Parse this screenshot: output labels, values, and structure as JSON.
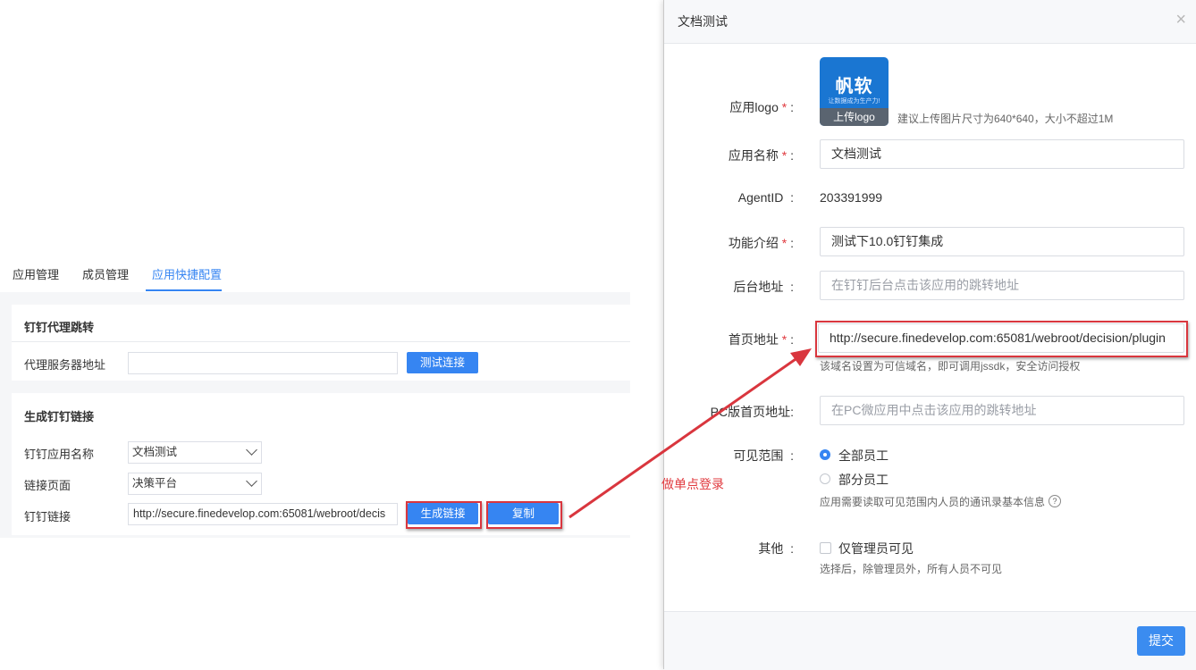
{
  "tabs": [
    {
      "label": "应用管理"
    },
    {
      "label": "成员管理"
    },
    {
      "label": "应用快捷配置"
    }
  ],
  "proxy_section": {
    "title": "钉钉代理跳转",
    "server_label": "代理服务器地址",
    "server_value": "",
    "test_button": "测试连接"
  },
  "link_section": {
    "title": "生成钉钉链接",
    "app_name_label": "钉钉应用名称",
    "app_name_value": "文档测试",
    "page_label": "链接页面",
    "page_value": "决策平台",
    "link_label": "钉钉链接",
    "link_value": "http://secure.finedevelop.com:65081/webroot/decis",
    "generate_button": "生成链接",
    "copy_button": "复制"
  },
  "annotation": "做单点登录",
  "modal": {
    "title": "文档测试",
    "close_glyph": "×",
    "logo": {
      "label": "应用logo",
      "brand_text": "帆软",
      "brand_sub": "让数据成为生产力!",
      "upload_label": "上传logo",
      "hint": "建议上传图片尺寸为640*640，大小不超过1M"
    },
    "app_name": {
      "label": "应用名称",
      "value": "文档测试"
    },
    "agent_id": {
      "label": "AgentID",
      "value": "203391999"
    },
    "description": {
      "label": "功能介绍",
      "value": "测试下10.0钉钉集成"
    },
    "backend_url": {
      "label": "后台地址",
      "placeholder": "在钉钉后台点击该应用的跳转地址"
    },
    "home_url": {
      "label": "首页地址",
      "value": "http://secure.finedevelop.com:65081/webroot/decision/plugin",
      "hint": "该域名设置为可信域名，即可调用jssdk，安全访问授权"
    },
    "pc_home_url": {
      "label": "PC版首页地址:",
      "placeholder": "在PC微应用中点击该应用的跳转地址"
    },
    "visibility": {
      "label": "可见范围",
      "option_all": "全部员工",
      "option_part": "部分员工",
      "hint": "应用需要读取可见范围内人员的通讯录基本信息",
      "selected": "全部员工"
    },
    "other": {
      "label": "其他",
      "checkbox_label": "仅管理员可见",
      "checked": false,
      "hint": "选择后，除管理员外，所有人员不可见"
    },
    "submit_button": "提交"
  },
  "colors": {
    "accent": "#3685f2",
    "highlight_box": "#d9363e",
    "required_mark": "#e0393e"
  }
}
